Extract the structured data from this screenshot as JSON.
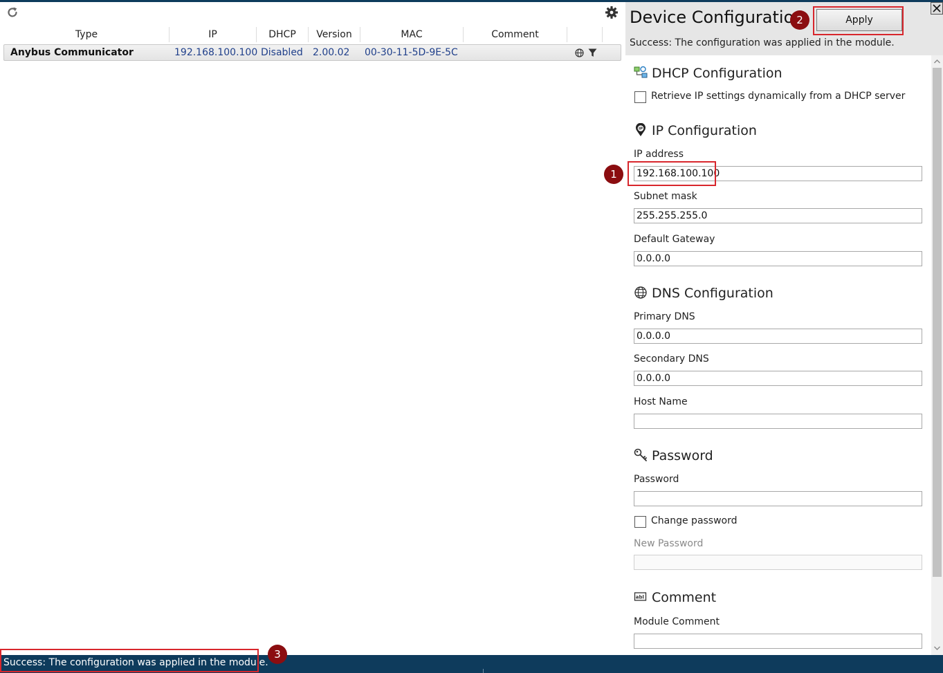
{
  "device_list": {
    "columns": [
      "Type",
      "IP",
      "DHCP",
      "Version",
      "MAC",
      "Comment"
    ],
    "rows": [
      {
        "type": "Anybus Communicator",
        "ip": "192.168.100.100",
        "dhcp": "Disabled",
        "version": "2.00.02",
        "mac": "00-30-11-5D-9E-5C",
        "comment": ""
      }
    ]
  },
  "config": {
    "title": "Device Configuration",
    "apply_label": "Apply",
    "status": "Success: The configuration was applied in the module.",
    "dhcp": {
      "title": "DHCP Configuration",
      "checkbox_label": "Retrieve IP settings dynamically from a DHCP server"
    },
    "ip": {
      "title": "IP Configuration",
      "ip_label": "IP address",
      "ip_value": "192.168.100.100",
      "subnet_label": "Subnet mask",
      "subnet_value": "255.255.255.0",
      "gateway_label": "Default Gateway",
      "gateway_value": "0.0.0.0"
    },
    "dns": {
      "title": "DNS Configuration",
      "primary_label": "Primary DNS",
      "primary_value": "0.0.0.0",
      "secondary_label": "Secondary DNS",
      "secondary_value": "0.0.0.0",
      "hostname_label": "Host Name",
      "hostname_value": ""
    },
    "password": {
      "title": "Password",
      "password_label": "Password",
      "password_value": "",
      "change_label": "Change password",
      "new_label": "New Password",
      "new_value": ""
    },
    "comment": {
      "title": "Comment",
      "module_label": "Module Comment",
      "module_value": ""
    }
  },
  "annotations": [
    "1",
    "2",
    "3"
  ],
  "status_bar": {
    "text": "Success: The configuration was applied in the module."
  },
  "colors": {
    "status_bar_bg": "#0e3b5c",
    "highlight_red": "#d8262c",
    "badge_bg": "#8b0d10",
    "row_value_text": "#1f3f8a"
  },
  "icons": {
    "refresh": "refresh-icon",
    "settings": "gear-icon",
    "web": "globe-icon",
    "filter": "filter-icon",
    "close": "close-icon",
    "dhcp": "network-icon",
    "ip": "ip-pin-icon",
    "dns": "globe-icon",
    "password": "key-icon",
    "comment": "text-field-icon"
  }
}
